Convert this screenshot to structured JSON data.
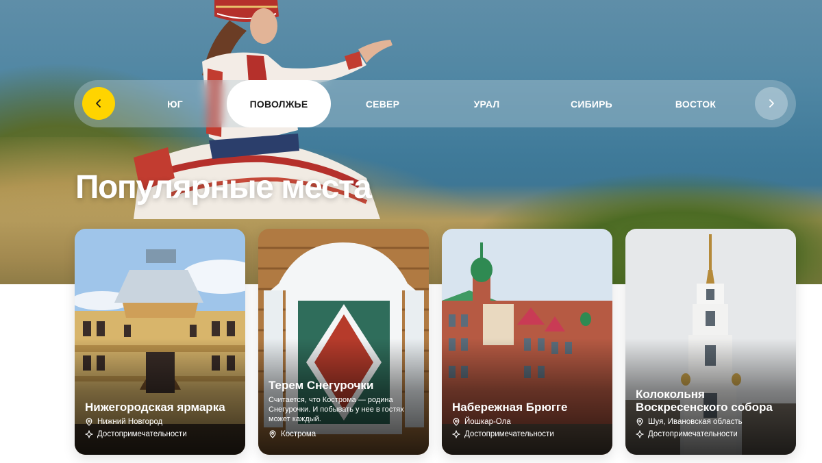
{
  "regions": {
    "prev_icon": "chevron-left-icon",
    "next_icon": "chevron-right-icon",
    "tabs": [
      {
        "label": "ЮГ",
        "active": false
      },
      {
        "label": "ПОВОЛЖЬЕ",
        "active": true
      },
      {
        "label": "СЕВЕР",
        "active": false
      },
      {
        "label": "УРАЛ",
        "active": false
      },
      {
        "label": "СИБИРЬ",
        "active": false
      },
      {
        "label": "ВОСТОК",
        "active": false
      }
    ]
  },
  "section": {
    "title": "Популярные места"
  },
  "colors": {
    "accent": "#ffd400",
    "text_light": "#ffffff",
    "text_dark": "#1a1a1a"
  },
  "cards": [
    {
      "title": "Нижегородская ярмарка",
      "location": "Нижний Новгород",
      "category": "Достопримечательности",
      "location_icon": "pin-icon",
      "category_icon": "sparkle-icon"
    },
    {
      "title": "Терем Снегурочки",
      "description": "Считается, что Кострома — родина Снегурочки. И побывать у нее в гостях может каждый.",
      "location": "Кострома",
      "location_icon": "pin-icon"
    },
    {
      "title": "Набережная Брюгге",
      "location": "Йошкар-Ола",
      "category": "Достопримечательности",
      "location_icon": "pin-icon",
      "category_icon": "sparkle-icon"
    },
    {
      "title": "Колокольня Воскресенского собора",
      "location": "Шуя, Ивановская область",
      "category": "Достопримечательности",
      "location_icon": "pin-icon",
      "category_icon": "sparkle-icon"
    }
  ]
}
